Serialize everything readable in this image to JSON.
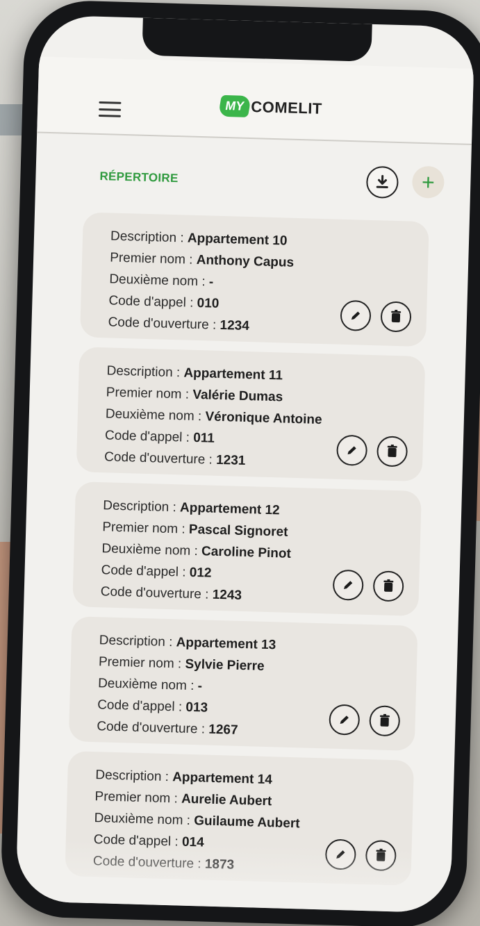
{
  "brand": {
    "badge": "MY",
    "name": "COMELIT",
    "accent": "#3bb54a"
  },
  "header": {
    "menu_icon": "hamburger-icon"
  },
  "section": {
    "title": "RÉPERTOIRE",
    "download_icon": "download-icon",
    "add_label": "+"
  },
  "labels": {
    "description": "Description : ",
    "first_name": "Premier nom : ",
    "second_name": "Deuxième nom : ",
    "call_code": "Code d'appel : ",
    "open_code": "Code d'ouverture : "
  },
  "entries": [
    {
      "description": "Appartement 10",
      "first_name": "Anthony Capus",
      "second_name": "-",
      "call_code": "010",
      "open_code": "1234"
    },
    {
      "description": "Appartement 11",
      "first_name": "Valérie Dumas",
      "second_name": "Véronique Antoine",
      "call_code": "011",
      "open_code": "1231"
    },
    {
      "description": "Appartement 12",
      "first_name": "Pascal Signoret",
      "second_name": "Caroline Pinot",
      "call_code": "012",
      "open_code": "1243"
    },
    {
      "description": "Appartement 13",
      "first_name": "Sylvie Pierre",
      "second_name": "-",
      "call_code": "013",
      "open_code": "1267"
    },
    {
      "description": "Appartement 14",
      "first_name": "Aurelie Aubert",
      "second_name": "Guilaume Aubert",
      "call_code": "014",
      "open_code": "1873"
    }
  ],
  "actions": {
    "edit_icon": "pencil-icon",
    "delete_icon": "trash-icon"
  }
}
